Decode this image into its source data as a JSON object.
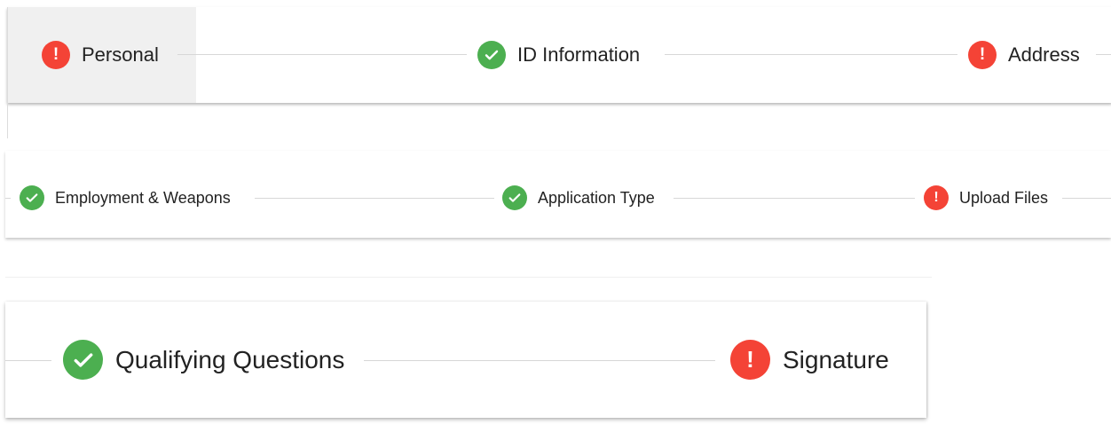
{
  "steppers": [
    {
      "steps": [
        {
          "label": "Personal",
          "status": "error",
          "active": true
        },
        {
          "label": "ID Information",
          "status": "complete"
        },
        {
          "label": "Address",
          "status": "error"
        }
      ]
    },
    {
      "steps": [
        {
          "label": "Employment & Weapons",
          "status": "complete"
        },
        {
          "label": "Application Type",
          "status": "complete"
        },
        {
          "label": "Upload Files",
          "status": "error"
        }
      ]
    },
    {
      "steps": [
        {
          "label": "Qualifying Questions",
          "status": "complete"
        },
        {
          "label": "Signature",
          "status": "error"
        }
      ]
    }
  ],
  "icons": {
    "error": "exclamation-icon",
    "complete": "check-icon"
  },
  "colors": {
    "error": "#f44336",
    "complete": "#4caf50",
    "connector": "#d7d7d7",
    "active_background": "#f0f0f0"
  }
}
